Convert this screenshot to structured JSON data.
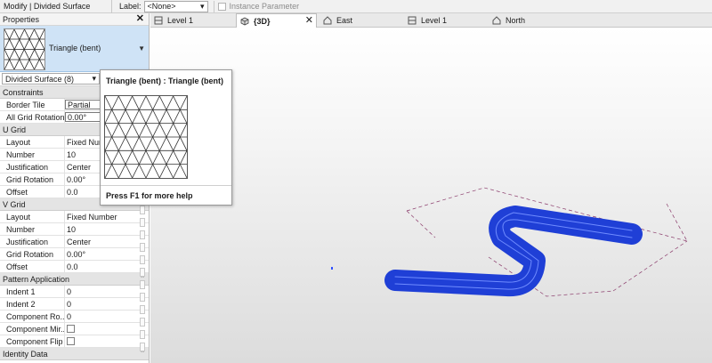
{
  "options_bar": {
    "mode": "Modify | Divided Surface",
    "label_caption": "Label:",
    "label_value": "<None>",
    "instance_param": "Instance Parameter"
  },
  "properties": {
    "title": "Properties",
    "type_name": "Triangle (bent)",
    "instance_selector": "Divided Surface (8)",
    "sections": {
      "constraints": "Constraints",
      "u_grid": "U Grid",
      "v_grid": "V Grid",
      "pattern_application": "Pattern Application",
      "identity_data": "Identity Data"
    },
    "constraints": [
      {
        "name": "Border Tile",
        "value": "Partial"
      },
      {
        "name": "All Grid Rotation",
        "value": "0.00°"
      }
    ],
    "u_grid": [
      {
        "name": "Layout",
        "value": "Fixed Number"
      },
      {
        "name": "Number",
        "value": "10"
      },
      {
        "name": "Justification",
        "value": "Center"
      },
      {
        "name": "Grid Rotation",
        "value": "0.00°"
      },
      {
        "name": "Offset",
        "value": "0.0"
      }
    ],
    "v_grid": [
      {
        "name": "Layout",
        "value": "Fixed Number"
      },
      {
        "name": "Number",
        "value": "10"
      },
      {
        "name": "Justification",
        "value": "Center"
      },
      {
        "name": "Grid Rotation",
        "value": "0.00°"
      },
      {
        "name": "Offset",
        "value": "0.0"
      }
    ],
    "pattern_application": [
      {
        "name": "Indent 1",
        "value": "0"
      },
      {
        "name": "Indent 2",
        "value": "0"
      },
      {
        "name": "Component Ro...",
        "value": "0"
      },
      {
        "name": "Component Mir...",
        "value": ""
      },
      {
        "name": "Component Flip",
        "value": ""
      }
    ]
  },
  "tooltip": {
    "title": "Triangle (bent) : Triangle (bent)",
    "help": "Press F1 for more help"
  },
  "tabs": [
    {
      "label": "Level 1"
    },
    {
      "label": "{3D}"
    },
    {
      "label": "East"
    },
    {
      "label": "Level 1"
    },
    {
      "label": "North"
    }
  ],
  "colors": {
    "model_blue": "#1f3fd6",
    "selection_bg": "#cfe3f6",
    "ref_lines": "#8a3a6a"
  }
}
